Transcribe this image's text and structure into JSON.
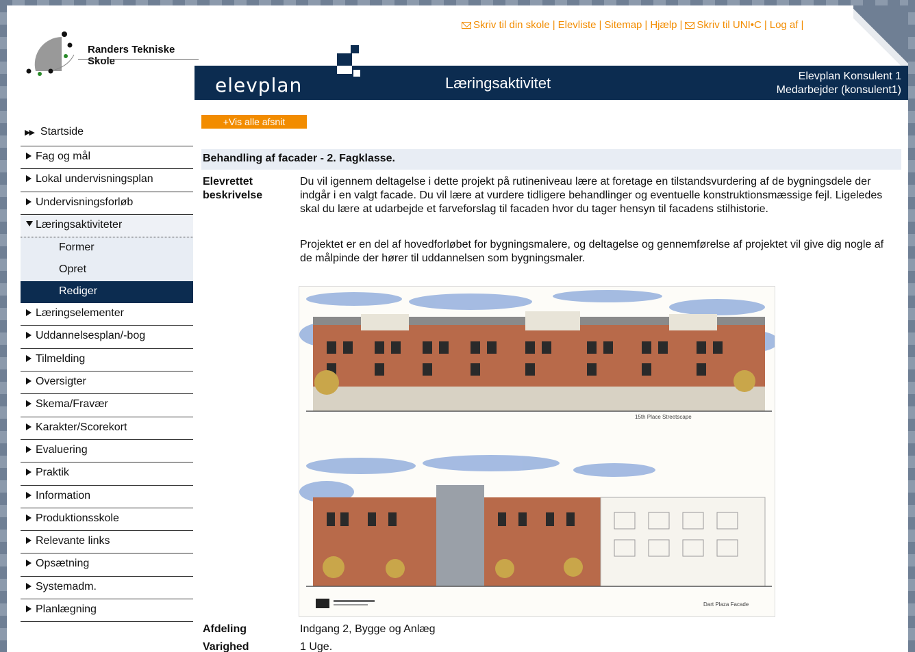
{
  "school": {
    "name": "Randers Tekniske Skole"
  },
  "toplinks": [
    {
      "label": "Skriv til din skole",
      "icon": "mail-icon"
    },
    {
      "label": "Elevliste"
    },
    {
      "label": "Sitemap"
    },
    {
      "label": "Hjælp"
    },
    {
      "label": "Skriv til UNI•C",
      "icon": "mail-icon"
    },
    {
      "label": "Log af"
    }
  ],
  "header": {
    "logo_text": "elevplan",
    "title": "Læringsaktivitet",
    "user_name": "Elevplan Konsulent 1",
    "user_role": "Medarbejder (konsulent1)"
  },
  "nav": {
    "start": "Startside",
    "items_before": [
      "Fag og mål",
      "Lokal undervisningsplan",
      "Undervisningsforløb"
    ],
    "open_item": "Læringsaktiviteter",
    "subitems": [
      "Former",
      "Opret",
      "Rediger"
    ],
    "active_sub": "Rediger",
    "items_after": [
      "Læringselementer",
      "Uddannelsesplan/-bog",
      "Tilmelding",
      "Oversigter",
      "Skema/Fravær",
      "Karakter/Scorekort",
      "Evaluering",
      "Praktik",
      "Information",
      "Produktionsskole",
      "Relevante links",
      "Opsætning",
      "Systemadm.",
      "Planlægning"
    ]
  },
  "content": {
    "vis_button": "+Vis alle afsnit",
    "heading": "Behandling af facader - 2. Fagklasse.",
    "desc_label_1": "Elevrettet",
    "desc_label_2": "beskrivelse",
    "desc_p1": "Du vil igennem deltagelse i dette projekt på rutineniveau lære at foretage en tilstandsvurdering af de bygningsdele der indgår i en valgt facade. Du vil lære at vurdere tidligere behandlinger og eventuelle konstruktionsmæssige fejl. Ligeledes skal du lære at udarbejde et farveforslag til facaden hvor du tager hensyn til facadens stilhistorie.",
    "desc_p2": "Projektet er en del af hovedforløbet for bygningsmalere, og deltagelse og gennemførelse af projektet vil give dig nogle af de målpinde der hører til uddannelsen som bygningsmaler.",
    "image_caption_top": "15th Place Streetscape",
    "image_caption_bottom": "Dart Plaza Facade",
    "afdeling_label": "Afdeling",
    "afdeling_value": "Indgang 2, Bygge og Anlæg",
    "varighed_label": "Varighed",
    "varighed_value": "1 Uge."
  },
  "colors": {
    "accent": "#f28c00",
    "header_blue": "#0c2c50",
    "nav_highlight": "#e8edf4"
  }
}
